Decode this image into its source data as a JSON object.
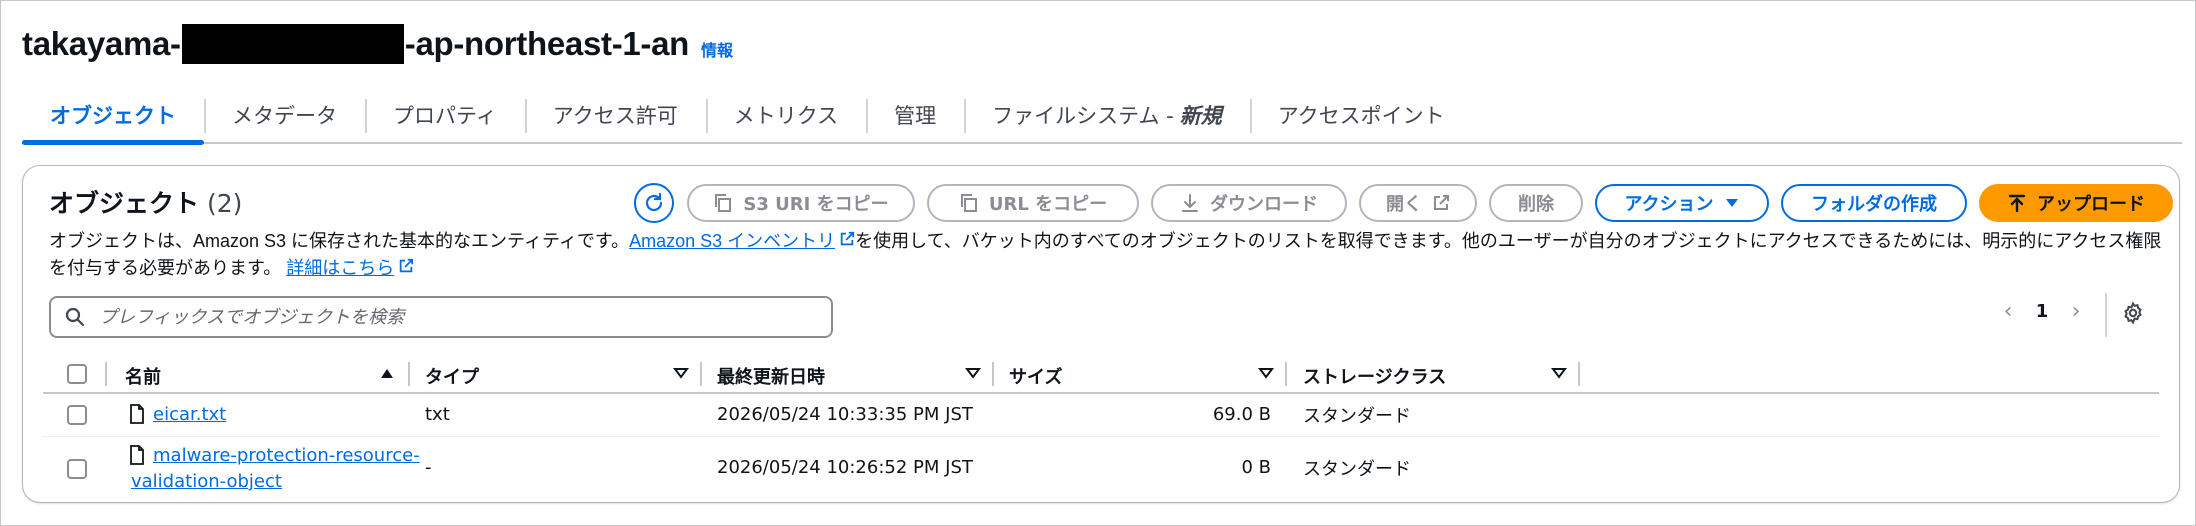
{
  "header": {
    "title_prefix": "takayama-",
    "title_suffix": "-ap-northeast-1-an",
    "info_link": "情報"
  },
  "tabs": [
    {
      "label": "オブジェクト",
      "active": true
    },
    {
      "label": "メタデータ"
    },
    {
      "label": "プロパティ"
    },
    {
      "label": "アクセス許可"
    },
    {
      "label": "メトリクス"
    },
    {
      "label": "管理"
    },
    {
      "label": "ファイルシステム - ",
      "emphasis": "新規"
    },
    {
      "label": "アクセスポイント"
    }
  ],
  "panel": {
    "title": "オブジェクト",
    "count": "(2)",
    "description_before": "オブジェクトは、Amazon S3 に保存された基本的なエンティティです。",
    "inventory_link": "Amazon S3 インベントリ",
    "description_after": "を使用して、バケット内のすべてのオブジェクトのリストを取得できます。他のユーザーが自分のオブジェクトにアクセスできるためには、明示的にアクセス権限を付与する必要があります。",
    "details_link": "詳細はこちら"
  },
  "toolbar": {
    "copy_s3_uri": "S3 URI をコピー",
    "copy_url": "URL をコピー",
    "download": "ダウンロード",
    "open": "開く",
    "delete": "削除",
    "actions": "アクション",
    "create_folder": "フォルダの作成",
    "upload": "アップロード"
  },
  "search": {
    "placeholder": "プレフィックスでオブジェクトを検索"
  },
  "pagination": {
    "current_page": "1"
  },
  "table": {
    "columns": [
      "名前",
      "タイプ",
      "最終更新日時",
      "サイズ",
      "ストレージクラス"
    ],
    "rows": [
      {
        "name": "eicar.txt",
        "type": "txt",
        "modified": "2026/05/24 10:33:35 PM JST",
        "size": "69.0 B",
        "storage_class": "スタンダード"
      },
      {
        "name_line1": "malware-protection-resource-",
        "name_line2": "validation-object",
        "type": "-",
        "modified": "2026/05/24 10:26:52 PM JST",
        "size": "0 B",
        "storage_class": "スタンダード"
      }
    ]
  },
  "colors": {
    "link": "#006ce0",
    "primary": "#ff9900",
    "text": "#0f141a",
    "disabled": "#8c8c94"
  }
}
